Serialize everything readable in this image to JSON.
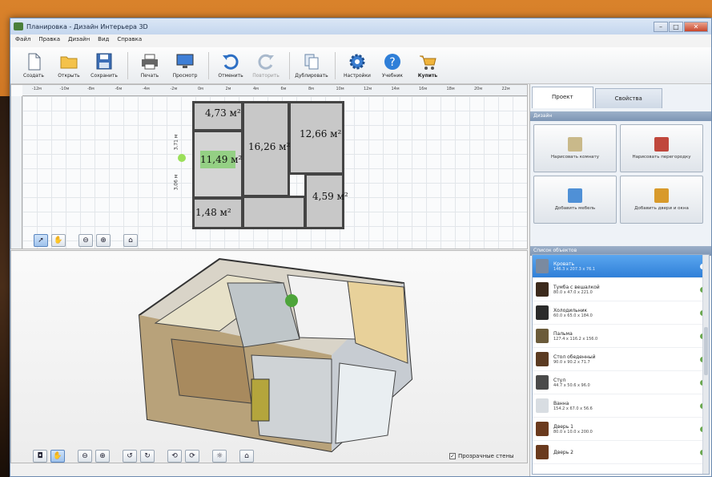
{
  "window": {
    "title": "Планировка - Дизайн Интерьера 3D"
  },
  "menu": [
    "Файл",
    "Правка",
    "Дизайн",
    "Вид",
    "Справка"
  ],
  "toolbar": [
    {
      "label": "Создать",
      "icon": "new-file-icon"
    },
    {
      "label": "Открыть",
      "icon": "folder-open-icon"
    },
    {
      "label": "Сохранить",
      "icon": "save-icon"
    },
    {
      "label": "Печать",
      "icon": "printer-icon"
    },
    {
      "label": "Просмотр",
      "icon": "monitor-icon"
    },
    {
      "label": "Отменить",
      "icon": "undo-icon"
    },
    {
      "label": "Повторить",
      "icon": "redo-icon",
      "disabled": true
    },
    {
      "label": "Дублировать",
      "icon": "duplicate-icon"
    },
    {
      "label": "Настройки",
      "icon": "gear-icon"
    },
    {
      "label": "Учебник",
      "icon": "help-icon"
    },
    {
      "label": "Купить",
      "icon": "cart-icon"
    }
  ],
  "ruler_ticks": [
    "-12м",
    "-10м",
    "-8м",
    "-6м",
    "-4м",
    "-2м",
    "0м",
    "2м",
    "4м",
    "6м",
    "8м",
    "10м",
    "12м",
    "14м",
    "16м",
    "18м",
    "20м",
    "22м"
  ],
  "rooms": [
    "4,73 м²",
    "16,26 м²",
    "12,66 м²",
    "11,49 м²",
    "4,59 м²",
    "1,48 м²"
  ],
  "dimensions": [
    "3,71 м",
    "3,06 м"
  ],
  "view3d": {
    "transparent_walls_label": "Прозрачные стены",
    "transparent_walls_checked": true
  },
  "side": {
    "tabs": [
      "Проект",
      "Свойства"
    ],
    "design_title": "Дизайн",
    "design_buttons": [
      "Нарисовать комнату",
      "Нарисовать перегородку",
      "Добавить мебель",
      "Добавить двери и окна"
    ],
    "objects_title": "Список объектов",
    "objects": [
      {
        "name": "Кровать",
        "dims": "146.3 x 207.3 x 76.1",
        "selected": true
      },
      {
        "name": "Тумба с вешалкой",
        "dims": "80.0 x 47.0 x 221.0"
      },
      {
        "name": "Холодильник",
        "dims": "60.0 x 65.0 x 184.0"
      },
      {
        "name": "Пальма",
        "dims": "127.4 x 116.2 x 156.0"
      },
      {
        "name": "Стол обеденный",
        "dims": "90.0 x 90.2 x 71.7"
      },
      {
        "name": "Стул",
        "dims": "44.7 x 50.6 x 96.0"
      },
      {
        "name": "Ванна",
        "dims": "154.2 x 67.0 x 56.6"
      },
      {
        "name": "Дверь 1",
        "dims": "80.0 x 10.0 x 200.0"
      },
      {
        "name": "Дверь 2",
        "dims": ""
      }
    ]
  }
}
